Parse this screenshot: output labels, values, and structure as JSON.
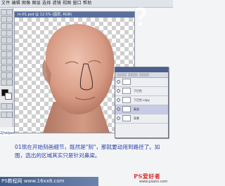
{
  "app": {
    "menu": "文件 编辑 图像 图层 选择 滤镜 视图 窗口 帮助",
    "watermark_top_right": "?"
  },
  "document": {
    "title": "m-01.psd @ 12.5% (图层, RGB)"
  },
  "layers_panel": {
    "rows": [
      {
        "label": ""
      },
      {
        "label": "下巴色"
      },
      {
        "label": "下巴色 copy"
      },
      {
        "label": "鼻梁"
      },
      {
        "label": "背景"
      }
    ]
  },
  "side_label": "2jhelper",
  "caption": "01现在开始刻画细节，既然是\"刻\"，那就要动用到路径了。如图，选出的区域其实只是针对鼻梁。",
  "footer": {
    "left_text": "PS教程网 www.16xx8.com",
    "logo_main": "PS爱好者",
    "logo_sub": "www.psahz.com"
  },
  "colors": {
    "caption": "#2740a8",
    "skin_light": "#e9b8a2",
    "skin_shadow": "#b9806b",
    "path_stroke": "#3b2a28"
  }
}
